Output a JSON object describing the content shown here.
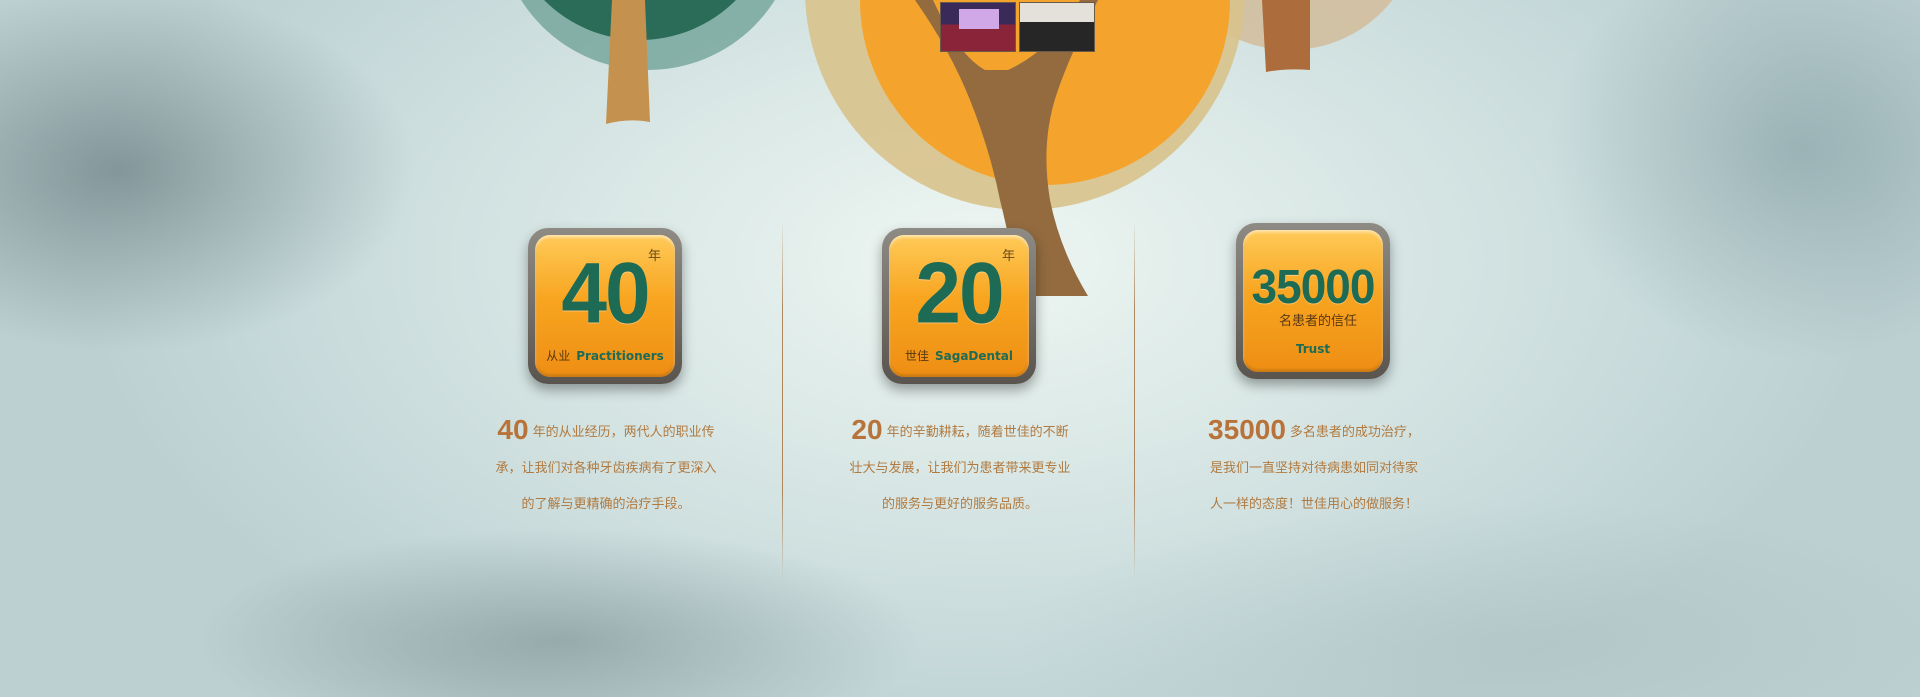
{
  "palette": {
    "accent_orange": "#f7a32a",
    "accent_green": "#1e6b55",
    "text_brown": "#b07a40"
  },
  "photos": [
    {
      "icon": "event-stage-photo"
    },
    {
      "icon": "group-photo"
    }
  ],
  "stats": [
    {
      "number": "40",
      "unit": "年",
      "caption_cn": "从业",
      "caption_en": "Practitioners",
      "desc_number": "40",
      "desc_line1": "年的从业经历，两代人的职业传",
      "desc_line2": "承，让我们对各种牙齿疾病有了更深入",
      "desc_line3": "的了解与更精确的治疗手段。"
    },
    {
      "number": "20",
      "unit": "年",
      "caption_cn": "世佳",
      "caption_en": "SagaDental",
      "desc_number": "20",
      "desc_line1": "年的辛勤耕耘，随着世佳的不断",
      "desc_line2": "壮大与发展，让我们为患者带来更专业",
      "desc_line3": "的服务与更好的服务品质。"
    },
    {
      "number": "35000",
      "subtitle": "名患者的信任",
      "caption_en": "Trust",
      "desc_number": "35000",
      "desc_line1": "多名患者的成功治疗，",
      "desc_line2": "是我们一直坚持对待病患如同对待家",
      "desc_line3": "人一样的态度！世佳用心的做服务！"
    }
  ]
}
